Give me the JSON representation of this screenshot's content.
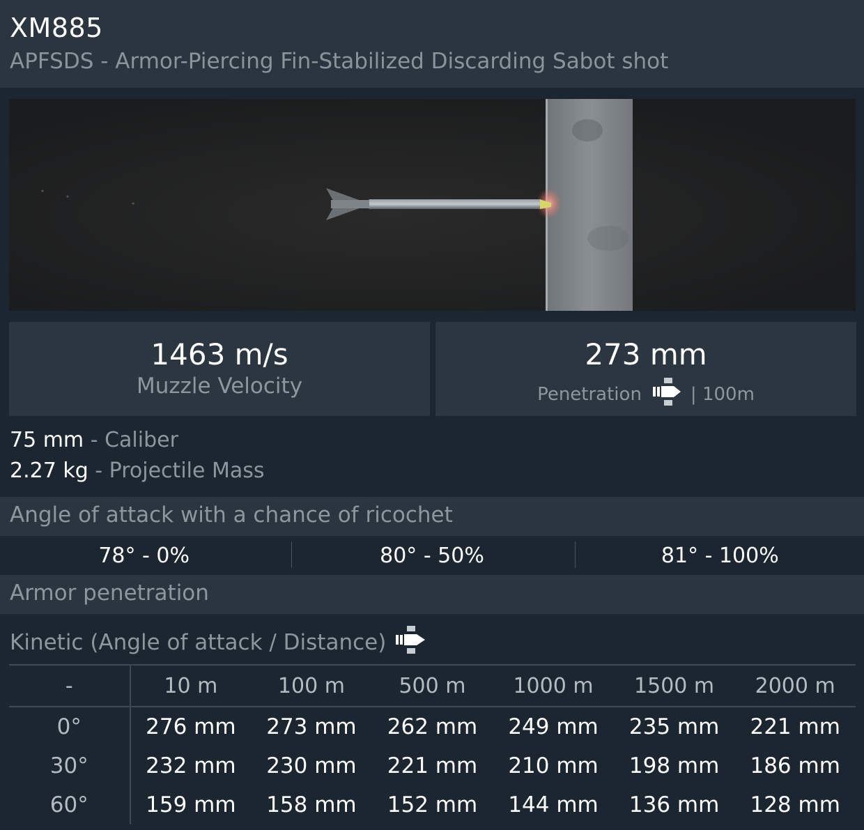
{
  "header": {
    "title": "XM885",
    "subtitle": "APFSDS - Armor-Piercing Fin-Stabilized Discarding Sabot shot"
  },
  "stats": {
    "muzzle_velocity_value": "1463 m/s",
    "muzzle_velocity_label": "Muzzle Velocity",
    "penetration_value": "273 mm",
    "penetration_label": "Penetration",
    "penetration_distance": "| 100m"
  },
  "properties": {
    "caliber_value": "75 mm",
    "caliber_label": "Caliber",
    "mass_value": "2.27 kg",
    "mass_label": "Projectile Mass",
    "separator": "-"
  },
  "ricochet": {
    "title": "Angle of attack with a chance of ricochet",
    "items": [
      "78° - 0%",
      "80° - 50%",
      "81° - 100%"
    ]
  },
  "armor_penetration": {
    "title": "Armor penetration",
    "kinetic_label": "Kinetic (Angle of attack / Distance)",
    "columns": [
      "-",
      "10 m",
      "100 m",
      "500 m",
      "1000 m",
      "1500 m",
      "2000 m"
    ],
    "rows": [
      {
        "angle": "0°",
        "values": [
          "276 mm",
          "273 mm",
          "262 mm",
          "249 mm",
          "235 mm",
          "221 mm"
        ]
      },
      {
        "angle": "30°",
        "values": [
          "232 mm",
          "230 mm",
          "221 mm",
          "210 mm",
          "198 mm",
          "186 mm"
        ]
      },
      {
        "angle": "60°",
        "values": [
          "159 mm",
          "158 mm",
          "152 mm",
          "144 mm",
          "136 mm",
          "128 mm"
        ]
      }
    ]
  },
  "icons": {
    "shell_icon": "shell-icon",
    "projectile_preview": "projectile-penetration-image"
  },
  "colors": {
    "background": "#1c2630",
    "header_bg": "#2a3540",
    "panel_bg": "#2c3641",
    "muted_text": "#8e979e",
    "text": "#ffffff"
  }
}
